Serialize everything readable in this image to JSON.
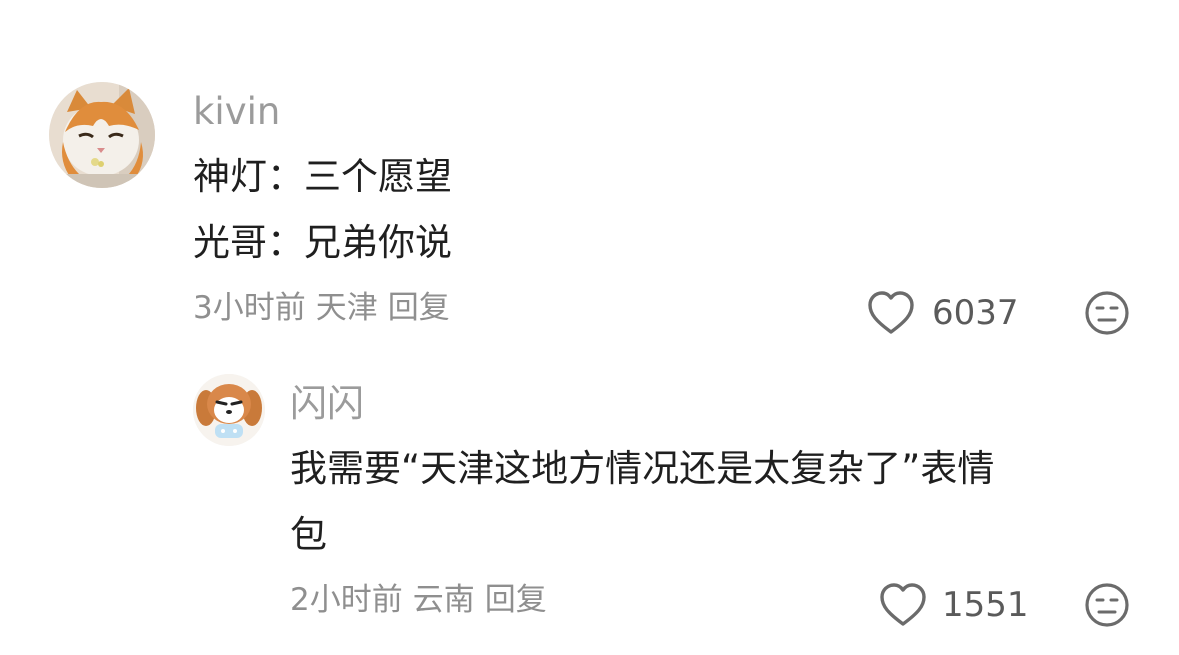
{
  "comments": [
    {
      "username": "kivin",
      "lines": [
        "神灯：三个愿望",
        "光哥：兄弟你说"
      ],
      "time": "3小时前",
      "location": "天津",
      "reply_label": "回复",
      "likes": "6037",
      "avatar": "cat-avatar"
    },
    {
      "username": "闪闪",
      "lines": [
        "我需要“天津这地方情况还是太复杂了”表情",
        "包"
      ],
      "time": "2小时前",
      "location": "云南",
      "reply_label": "回复",
      "likes": "1551",
      "avatar": "dog-cartoon-avatar"
    }
  ],
  "icons": {
    "like": "heart-outline-icon",
    "dislike": "meh-face-icon"
  },
  "colors": {
    "username": "#9b9b9b",
    "text": "#1f1f1f",
    "meta": "#8f8f8f",
    "icon": "#6b6b6b"
  }
}
